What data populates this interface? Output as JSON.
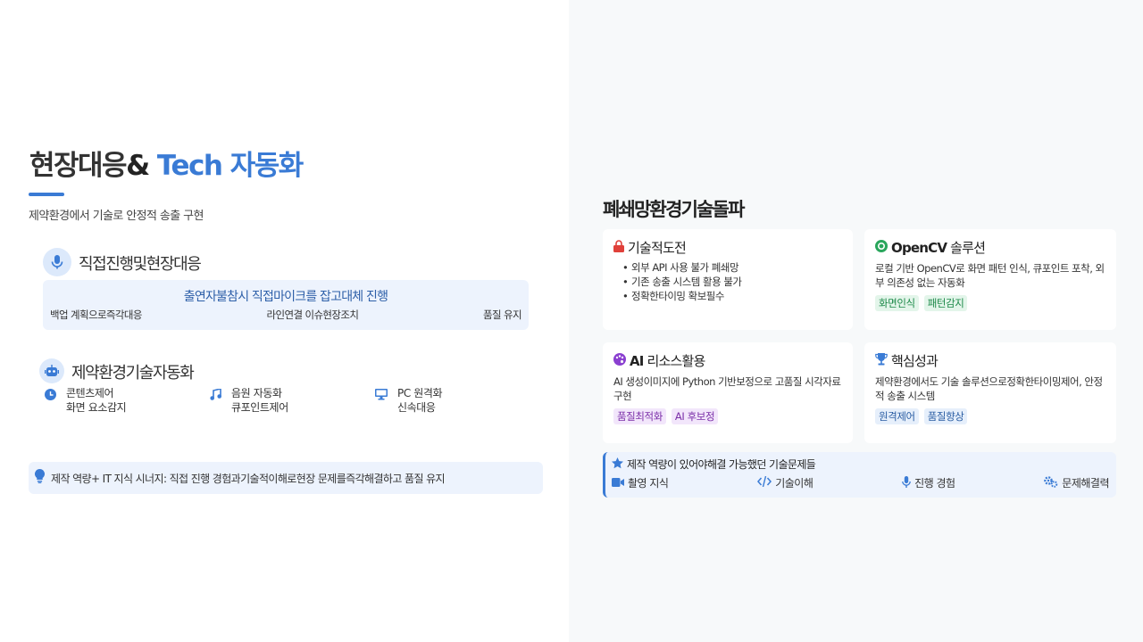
{
  "left": {
    "title": {
      "part1": "현장대응",
      "part2": "& ",
      "part3": "Tech",
      "part4": " 자동화"
    },
    "subtitle": "제약환경에서 기술로 안정적 송출 구현",
    "live_section": {
      "title": "직접진행및현장대응",
      "main": "출연자불참시 직접마이크를 잡고대체 진행",
      "items": [
        "백업 계획으로즉각대응",
        "라인연결 이슈현장조치",
        "품질 유지"
      ]
    },
    "auto_section": {
      "title": "제약환경기술자동화",
      "items": [
        {
          "icon": "clock-icon",
          "line1": "콘텐츠제어",
          "line2": "화면 요소감지"
        },
        {
          "icon": "music-note-icon",
          "line1": "음원 자동화",
          "line2": "큐포인트제어"
        },
        {
          "icon": "monitor-icon",
          "line1": "PC 원격화",
          "line2": "신속대응"
        }
      ]
    },
    "synergy": "제작 역량+ IT 지식 시너지: 직접 진행 경험과기술적이해로현장 문제를즉각해결하고 품질 유지"
  },
  "right": {
    "title": "폐쇄망환경기술돌파",
    "cards": {
      "challenge": {
        "title": "기술적도전",
        "items": [
          "외부 API 사용 불가 폐쇄망",
          "기존 송출 시스템 활용 불가",
          "정확한타이밍 확보필수"
        ]
      },
      "opencv": {
        "title_bold": "OpenCV",
        "title_rest": " 솔루션",
        "body": "로컬 기반 OpenCV로 화면 패턴 인식, 큐포인트 포착, 외부 의존성 없는 자동화",
        "tags": [
          "화면인식",
          "패턴감지"
        ]
      },
      "ai": {
        "title_bold": "AI",
        "title_rest": " 리소스활용",
        "body": "AI 생성이미지에 Python 기반보정으로 고품질 시각자료 구현",
        "tags": [
          "품질최적화",
          "AI 후보정"
        ]
      },
      "result": {
        "title": "핵심성과",
        "body": "제약환경에서도 기술 솔루션으로정확한타이밍제어, 안정적 송출 시스템",
        "tags": [
          "원격제어",
          "품질향상"
        ]
      }
    },
    "bottom": {
      "title": "제작 역량이 있어야해결 가능했던 기술문제들",
      "items": [
        {
          "icon": "video-camera-icon",
          "label": "촬영 지식"
        },
        {
          "icon": "code-icon",
          "label": "기술이해"
        },
        {
          "icon": "microphone-icon",
          "label": "진행 경험"
        },
        {
          "icon": "gears-icon",
          "label": "문제해결력"
        }
      ]
    }
  },
  "colors": {
    "accent": "#3a7bd5",
    "red": "#e0403a",
    "green": "#2aa65c",
    "purple": "#8a3fd0",
    "panel": "#f7f9fa"
  }
}
